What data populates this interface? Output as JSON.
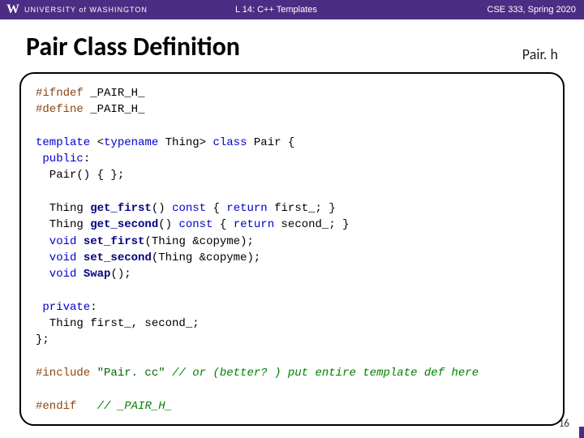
{
  "header": {
    "university": "UNIVERSITY of WASHINGTON",
    "lecture": "L 14: C++ Templates",
    "course": "CSE 333, Spring 2020"
  },
  "title": "Pair Class Definition",
  "filename": "Pair. h",
  "code": {
    "l1a": "#ifndef",
    "l1b": " _PAIR_H_",
    "l2a": "#define",
    "l2b": " _PAIR_H_",
    "l3a": "template",
    "l3b": " <",
    "l3c": "typename",
    "l3d": " Thing> ",
    "l3e": "class",
    "l3f": " Pair {",
    "l4a": " public",
    "l4b": ":",
    "l5": "  Pair() { };",
    "l6a": "  Thing ",
    "l6b": "get_first",
    "l6c": "() ",
    "l6d": "const",
    "l6e": " { ",
    "l6f": "return",
    "l6g": " first_; }",
    "l7a": "  Thing ",
    "l7b": "get_second",
    "l7c": "() ",
    "l7d": "const",
    "l7e": " { ",
    "l7f": "return",
    "l7g": " second_; }",
    "l8a": "  void",
    "l8b": " ",
    "l8c": "set_first",
    "l8d": "(Thing &copyme);",
    "l9a": "  void",
    "l9b": " ",
    "l9c": "set_second",
    "l9d": "(Thing &copyme);",
    "l10a": "  void",
    "l10b": " ",
    "l10c": "Swap",
    "l10d": "();",
    "l11a": " private",
    "l11b": ":",
    "l12": "  Thing first_, second_;",
    "l13": "};",
    "l14a": "#include",
    "l14b": " ",
    "l14c": "\"Pair. cc\"",
    "l14d": " ",
    "l14e": "// or (better? ) put entire template def here",
    "l15a": "#endif",
    "l15b": "   ",
    "l15c": "// _PAIR_H_"
  },
  "page": "16"
}
